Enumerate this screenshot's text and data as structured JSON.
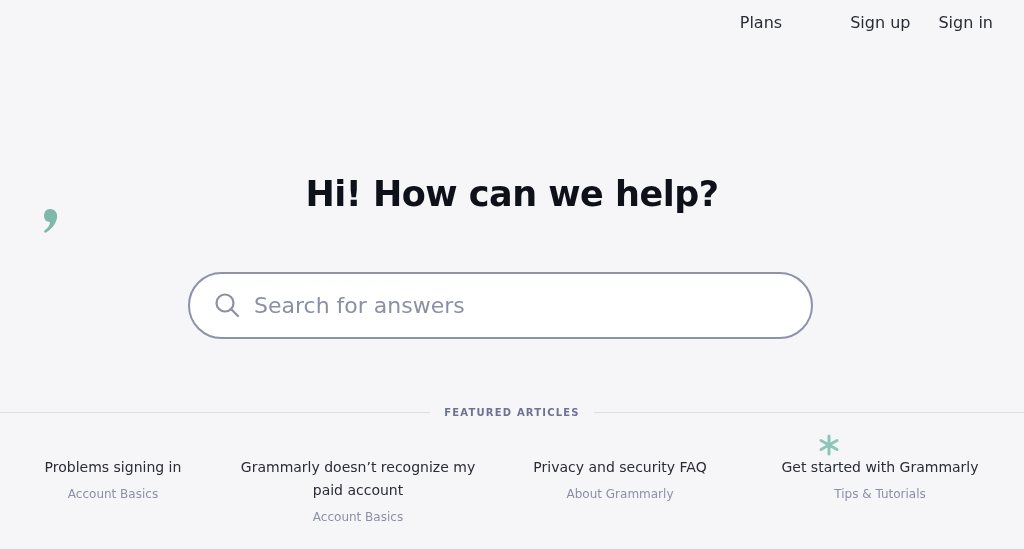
{
  "nav": {
    "links": [
      "Plans",
      "Sign up",
      "Sign in"
    ]
  },
  "hero": {
    "heading": "Hi! How can we help?"
  },
  "search": {
    "placeholder": "Search for answers"
  },
  "featured": {
    "title": "FEATURED ARTICLES",
    "articles": [
      {
        "title": "Problems signing in",
        "category": "Account Basics"
      },
      {
        "title": "Grammarly doesn’t recognize my paid account",
        "category": "Account Basics"
      },
      {
        "title": "Privacy and security FAQ",
        "category": "About Grammarly"
      },
      {
        "title": "Get started with Grammarly",
        "category": "Tips & Tutorials"
      }
    ]
  }
}
